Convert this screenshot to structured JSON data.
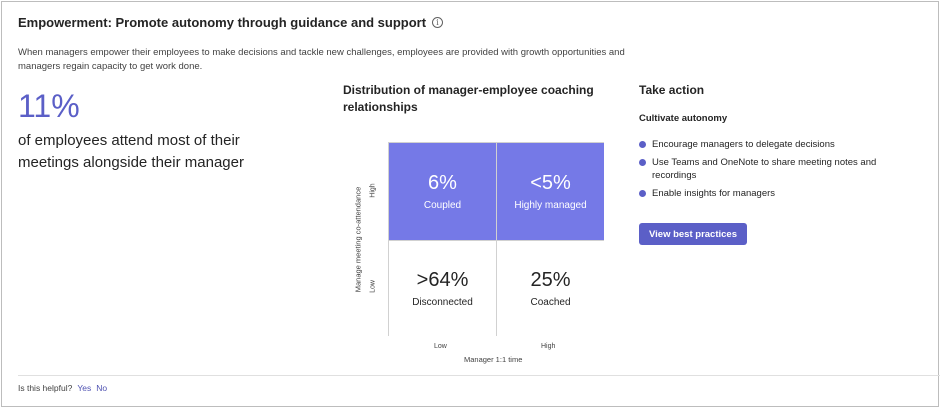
{
  "card": {
    "title": "Empowerment: Promote autonomy through guidance and support",
    "info_icon": "info-circle-icon",
    "description": "When managers empower their employees to make decisions and tackle new challenges, employees are provided with growth opportunities and managers regain capacity to get work done."
  },
  "stat": {
    "value": "11%",
    "text": "of employees attend most of their meetings alongside their manager"
  },
  "chart": {
    "title": "Distribution of manager-employee coaching relationships",
    "y_axis_label": "Manage meeting co-attendance",
    "x_axis_label": "Manager 1:1 time",
    "y_ticks": [
      "High",
      "Low"
    ],
    "x_ticks": [
      "Low",
      "High"
    ],
    "cells": [
      {
        "value": "6%",
        "label": "Coupled"
      },
      {
        "value": "<5%",
        "label": "Highly managed"
      },
      {
        "value": ">64%",
        "label": "Disconnected"
      },
      {
        "value": "25%",
        "label": "Coached"
      }
    ]
  },
  "chart_data": {
    "type": "table",
    "title": "Distribution of manager-employee coaching relationships",
    "xlabel": "Manager 1:1 time",
    "ylabel": "Manage meeting co-attendance",
    "rows": [
      "High",
      "Low"
    ],
    "columns": [
      "Low",
      "High"
    ],
    "values": [
      [
        "6%",
        "<5%"
      ],
      [
        ">64%",
        "25%"
      ]
    ],
    "labels": [
      [
        "Coupled",
        "Highly managed"
      ],
      [
        "Disconnected",
        "Coached"
      ]
    ]
  },
  "action": {
    "title": "Take action",
    "subtitle": "Cultivate autonomy",
    "bullets": [
      "Encourage managers to delegate decisions",
      "Use Teams and OneNote to share meeting notes and recordings",
      "Enable insights for managers"
    ],
    "button_label": "View best practices"
  },
  "footer": {
    "question": "Is this helpful?",
    "yes": "Yes",
    "no": "No"
  },
  "colors": {
    "accent": "#5b5fc7",
    "highlight_cell": "#7579e7"
  }
}
